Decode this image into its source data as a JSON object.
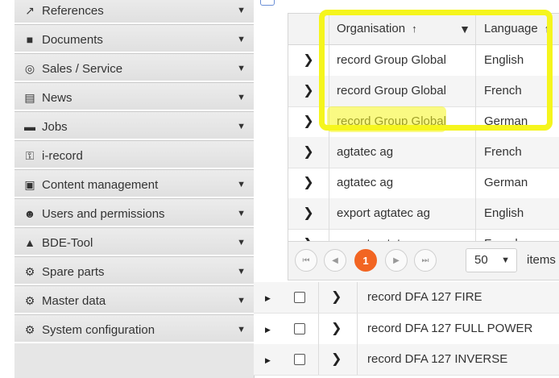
{
  "sidebar": {
    "items": [
      {
        "label": "References",
        "icon": "external-link-icon",
        "glyph": "↗",
        "caret": "▼"
      },
      {
        "label": "Documents",
        "icon": "document-icon",
        "glyph": "■",
        "caret": "▼"
      },
      {
        "label": "Sales / Service",
        "icon": "target-icon",
        "glyph": "◎",
        "caret": "▼"
      },
      {
        "label": "News",
        "icon": "newspaper-icon",
        "glyph": "▤",
        "caret": "▼"
      },
      {
        "label": "Jobs",
        "icon": "briefcase-icon",
        "glyph": "▬",
        "caret": "▼"
      },
      {
        "label": "i-record",
        "icon": "key-icon",
        "glyph": "⚿",
        "caret": ""
      },
      {
        "label": "Content management",
        "icon": "code-file-icon",
        "glyph": "▣",
        "caret": "▼"
      },
      {
        "label": "Users and permissions",
        "icon": "users-icon",
        "glyph": "☻",
        "caret": "▼"
      },
      {
        "label": "BDE-Tool",
        "icon": "warning-icon",
        "glyph": "▲",
        "caret": "▼"
      },
      {
        "label": "Spare parts",
        "icon": "gear-icon",
        "glyph": "⚙",
        "caret": "▼"
      },
      {
        "label": "Master data",
        "icon": "gear-icon",
        "glyph": "⚙",
        "caret": "▼"
      },
      {
        "label": "System configuration",
        "icon": "gear-icon",
        "glyph": "⚙",
        "caret": "▼"
      }
    ]
  },
  "grid": {
    "headers": {
      "organisation": "Organisation",
      "language": "Language",
      "sort_glyph": "↑",
      "filter_glyph": "▼"
    },
    "rows": [
      {
        "expand": "❯",
        "organisation": "record Group Global",
        "language": "English"
      },
      {
        "expand": "❯",
        "organisation": "record Group Global",
        "language": "French"
      },
      {
        "expand": "❯",
        "organisation": "record Group Global",
        "language": "German"
      },
      {
        "expand": "❯",
        "organisation": "agtatec ag",
        "language": "French"
      },
      {
        "expand": "❯",
        "organisation": "agtatec ag",
        "language": "German"
      },
      {
        "expand": "❯",
        "organisation": "export agtatec ag",
        "language": "English"
      },
      {
        "expand": "❯",
        "organisation": "export agtatec ag",
        "language": "French"
      }
    ],
    "pager": {
      "first": "⏮",
      "prev": "◀",
      "current_page": "1",
      "next": "▶",
      "last": "⏭",
      "page_size": "50",
      "page_size_caret": "▼",
      "items_label": "items"
    }
  },
  "list": {
    "rows": [
      {
        "toggle": "▶",
        "chevron": "❯",
        "label": "record DFA 127 FIRE"
      },
      {
        "toggle": "▶",
        "chevron": "❯",
        "label": "record DFA 127 FULL POWER"
      },
      {
        "toggle": "▶",
        "chevron": "❯",
        "label": "record DFA 127 INVERSE"
      }
    ]
  },
  "colors": {
    "highlight": "#f5f51d",
    "pager_active": "#f26522",
    "sidebar_bg": "#e6e6e6"
  }
}
